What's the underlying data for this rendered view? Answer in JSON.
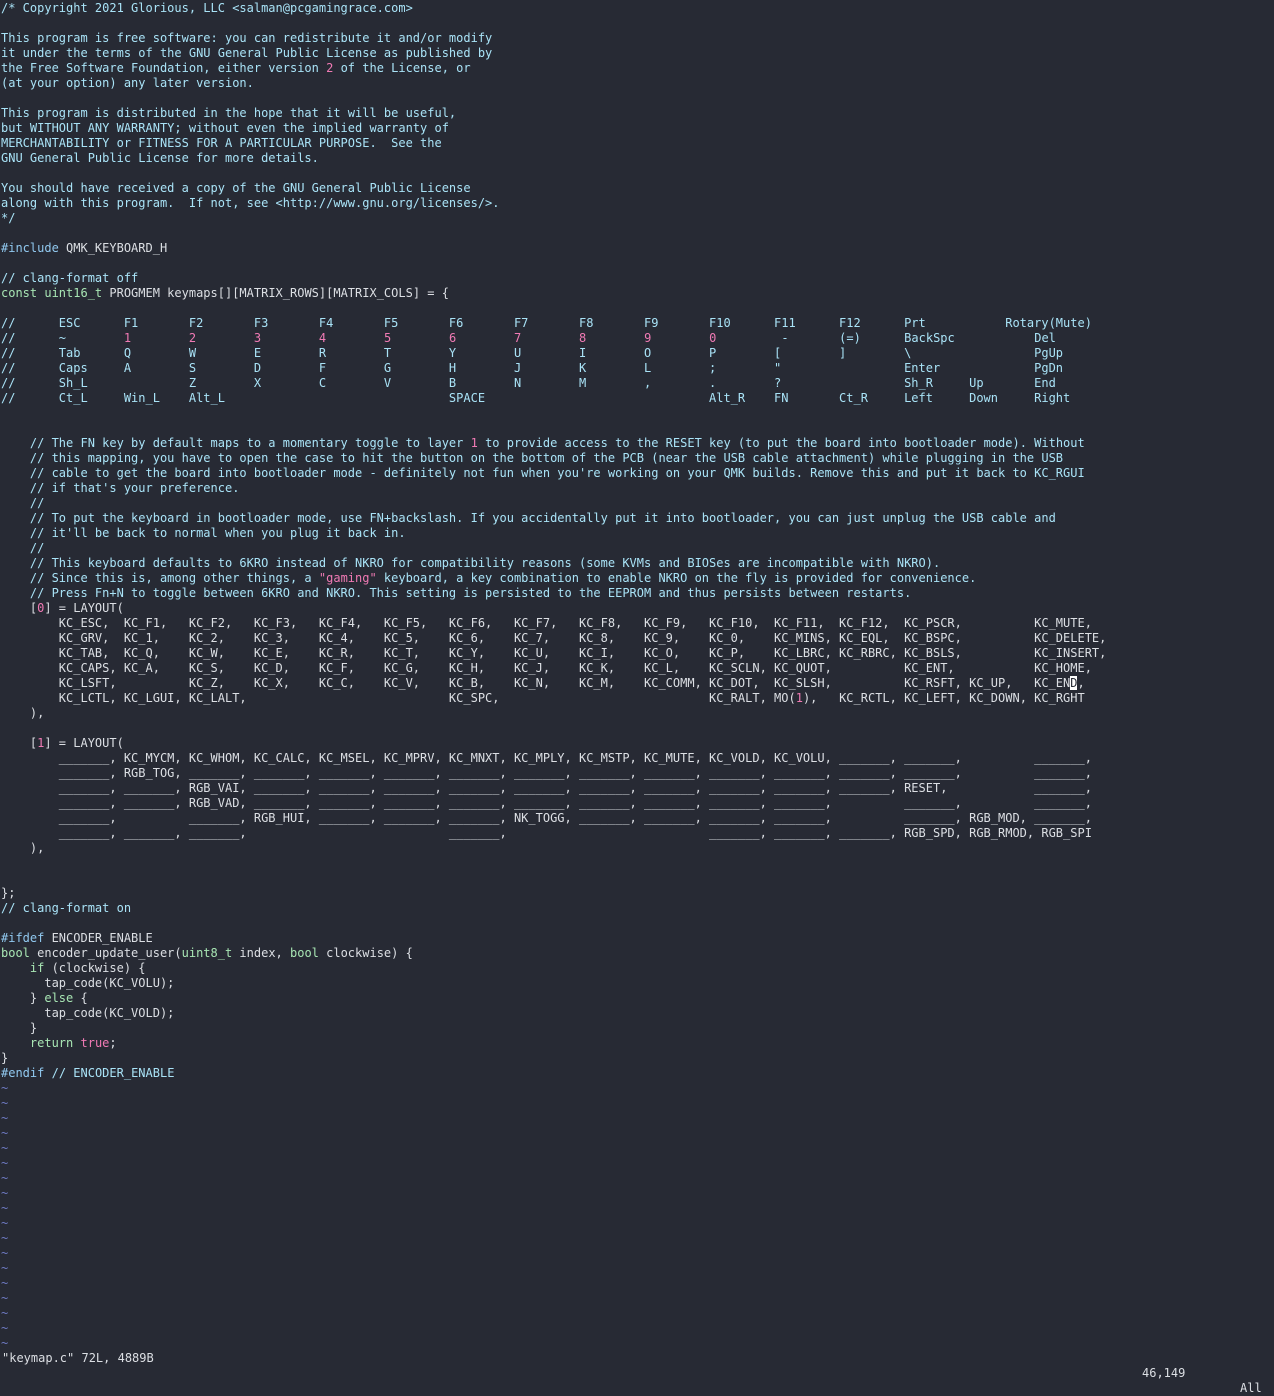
{
  "editor": {
    "lines": [
      {
        "t": "/* Copyright 2021 Glorious, LLC <salman@pcgamingrace.com>",
        "c": "com"
      },
      {
        "t": "",
        "c": ""
      },
      {
        "t": "This program is free software: you can redistribute it and/or modify",
        "c": "com"
      },
      {
        "t": "it under the terms of the GNU General Public License as published by",
        "c": "com"
      },
      {
        "t": "the Free Software Foundation, either version 2 of the License, or",
        "c": "com"
      },
      {
        "t": "(at your option) any later version.",
        "c": "com"
      },
      {
        "t": "",
        "c": ""
      },
      {
        "t": "This program is distributed in the hope that it will be useful,",
        "c": "com"
      },
      {
        "t": "but WITHOUT ANY WARRANTY; without even the implied warranty of",
        "c": "com"
      },
      {
        "t": "MERCHANTABILITY or FITNESS FOR A PARTICULAR PURPOSE.  See the",
        "c": "com"
      },
      {
        "t": "GNU General Public License for more details.",
        "c": "com"
      },
      {
        "t": "",
        "c": ""
      },
      {
        "t": "You should have received a copy of the GNU General Public License",
        "c": "com"
      },
      {
        "t": "along with this program.  If not, see <http://www.gnu.org/licenses/>.",
        "c": "com"
      },
      {
        "t": "*/",
        "c": "com"
      },
      {
        "t": "",
        "c": ""
      },
      {
        "t": "#include QMK_KEYBOARD_H",
        "c": ""
      },
      {
        "t": "",
        "c": ""
      },
      {
        "t": "// clang-format off",
        "c": "com"
      },
      {
        "t": "const uint16_t PROGMEM keymaps[][MATRIX_ROWS][MATRIX_COLS] = {",
        "c": ""
      },
      {
        "t": "",
        "c": ""
      },
      {
        "t": "//      ESC      F1       F2       F3       F4       F5       F6       F7       F8       F9       F10      F11      F12      Prt           Rotary(Mute)",
        "c": "com"
      },
      {
        "t": "//      ~        1        2        3        4        5        6        7        8        9        0         -       (=)      BackSpc           Del",
        "c": "com"
      },
      {
        "t": "//      Tab      Q        W        E        R        T        Y        U        I        O        P        [        ]        \\                 PgUp",
        "c": "com"
      },
      {
        "t": "//      Caps     A        S        D        F        G        H        J        K        L        ;        \"                 Enter             PgDn",
        "c": "com"
      },
      {
        "t": "//      Sh_L              Z        X        C        V        B        N        M        ,        .        ?                 Sh_R     Up       End",
        "c": "com"
      },
      {
        "t": "//      Ct_L     Win_L    Alt_L                               SPACE                               Alt_R    FN       Ct_R     Left     Down     Right",
        "c": "com"
      },
      {
        "t": "",
        "c": ""
      },
      {
        "t": "",
        "c": ""
      },
      {
        "t": "    // The FN key by default maps to a momentary toggle to layer 1 to provide access to the RESET key (to put the board into bootloader mode). Without",
        "c": "com"
      },
      {
        "t": "    // this mapping, you have to open the case to hit the button on the bottom of the PCB (near the USB cable attachment) while plugging in the USB",
        "c": "com"
      },
      {
        "t": "    // cable to get the board into bootloader mode - definitely not fun when you're working on your QMK builds. Remove this and put it back to KC_RGUI",
        "c": "com"
      },
      {
        "t": "    // if that's your preference.",
        "c": "com"
      },
      {
        "t": "    //",
        "c": "com"
      },
      {
        "t": "    // To put the keyboard in bootloader mode, use FN+backslash. If you accidentally put it into bootloader, you can just unplug the USB cable and",
        "c": "com"
      },
      {
        "t": "    // it'll be back to normal when you plug it back in.",
        "c": "com"
      },
      {
        "t": "    //",
        "c": "com"
      },
      {
        "t": "    // This keyboard defaults to 6KRO instead of NKRO for compatibility reasons (some KVMs and BIOSes are incompatible with NKRO).",
        "c": "com"
      },
      {
        "t": "    // Since this is, among other things, a \"gaming\" keyboard, a key combination to enable NKRO on the fly is provided for convenience.",
        "c": "com"
      },
      {
        "t": "    // Press Fn+N to toggle between 6KRO and NKRO. This setting is persisted to the EEPROM and thus persists between restarts.",
        "c": "com"
      },
      {
        "t": "    [0] = LAYOUT(",
        "c": ""
      },
      {
        "t": "        KC_ESC,  KC_F1,   KC_F2,   KC_F3,   KC_F4,   KC_F5,   KC_F6,   KC_F7,   KC_F8,   KC_F9,   KC_F10,  KC_F11,  KC_F12,  KC_PSCR,          KC_MUTE,",
        "c": ""
      },
      {
        "t": "        KC_GRV,  KC_1,    KC_2,    KC_3,    KC_4,    KC_5,    KC_6,    KC_7,    KC_8,    KC_9,    KC_0,    KC_MINS, KC_EQL,  KC_BSPC,          KC_DELETE,",
        "c": ""
      },
      {
        "t": "        KC_TAB,  KC_Q,    KC_W,    KC_E,    KC_R,    KC_T,    KC_Y,    KC_U,    KC_I,    KC_O,    KC_P,    KC_LBRC, KC_RBRC, KC_BSLS,          KC_INSERT,",
        "c": ""
      },
      {
        "t": "        KC_CAPS, KC_A,    KC_S,    KC_D,    KC_F,    KC_G,    KC_H,    KC_J,    KC_K,    KC_L,    KC_SCLN, KC_QUOT,          KC_ENT,           KC_HOME,",
        "c": ""
      },
      {
        "t": "        KC_LSFT,          KC_Z,    KC_X,    KC_C,    KC_V,    KC_B,    KC_N,    KC_M,    KC_COMM, KC_DOT,  KC_SLSH,          KC_RSFT, KC_UP,   KC_END,",
        "c": ""
      },
      {
        "t": "        KC_LCTL, KC_LGUI, KC_LALT,                            KC_SPC,                             KC_RALT, MO(1),   KC_RCTL, KC_LEFT, KC_DOWN, KC_RGHT",
        "c": ""
      },
      {
        "t": "    ),",
        "c": ""
      },
      {
        "t": "",
        "c": ""
      },
      {
        "t": "    [1] = LAYOUT(",
        "c": ""
      },
      {
        "t": "        _______, KC_MYCM, KC_WHOM, KC_CALC, KC_MSEL, KC_MPRV, KC_MNXT, KC_MPLY, KC_MSTP, KC_MUTE, KC_VOLD, KC_VOLU, _______, _______,          _______,",
        "c": ""
      },
      {
        "t": "        _______, RGB_TOG, _______, _______, _______, _______, _______, _______, _______, _______, _______, _______, _______, _______,          _______,",
        "c": ""
      },
      {
        "t": "        _______, _______, RGB_VAI, _______, _______, _______, _______, _______, _______, _______, _______, _______, _______, RESET,            _______,",
        "c": ""
      },
      {
        "t": "        _______, _______, RGB_VAD, _______, _______, _______, _______, _______, _______, _______, _______, _______,          _______,          _______,",
        "c": ""
      },
      {
        "t": "        _______,          _______, RGB_HUI, _______, _______, _______, NK_TOGG, _______, _______, _______, _______,          _______, RGB_MOD, _______,",
        "c": ""
      },
      {
        "t": "        _______, _______, _______,                            _______,                            _______, _______, _______, RGB_SPD, RGB_RMOD, RGB_SPI",
        "c": ""
      },
      {
        "t": "    ),",
        "c": ""
      },
      {
        "t": "",
        "c": ""
      },
      {
        "t": "",
        "c": ""
      },
      {
        "t": "};",
        "c": ""
      },
      {
        "t": "// clang-format on",
        "c": "com"
      },
      {
        "t": "",
        "c": ""
      },
      {
        "t": "#ifdef ENCODER_ENABLE",
        "c": ""
      },
      {
        "t": "bool encoder_update_user(uint8_t index, bool clockwise) {",
        "c": ""
      },
      {
        "t": "    if (clockwise) {",
        "c": ""
      },
      {
        "t": "      tap_code(KC_VOLU);",
        "c": ""
      },
      {
        "t": "    } else {",
        "c": ""
      },
      {
        "t": "      tap_code(KC_VOLD);",
        "c": ""
      },
      {
        "t": "    }",
        "c": ""
      },
      {
        "t": "    return true;",
        "c": ""
      },
      {
        "t": "}",
        "c": ""
      },
      {
        "t": "#endif // ENCODER_ENABLE",
        "c": ""
      },
      {
        "t": "~",
        "c": "tilde"
      },
      {
        "t": "~",
        "c": "tilde"
      },
      {
        "t": "~",
        "c": "tilde"
      },
      {
        "t": "~",
        "c": "tilde"
      },
      {
        "t": "~",
        "c": "tilde"
      },
      {
        "t": "~",
        "c": "tilde"
      },
      {
        "t": "~",
        "c": "tilde"
      },
      {
        "t": "~",
        "c": "tilde"
      },
      {
        "t": "~",
        "c": "tilde"
      },
      {
        "t": "~",
        "c": "tilde"
      },
      {
        "t": "~",
        "c": "tilde"
      },
      {
        "t": "~",
        "c": "tilde"
      },
      {
        "t": "~",
        "c": "tilde"
      },
      {
        "t": "~",
        "c": "tilde"
      },
      {
        "t": "~",
        "c": "tilde"
      },
      {
        "t": "~",
        "c": "tilde"
      },
      {
        "t": "~",
        "c": "tilde"
      },
      {
        "t": "~",
        "c": "tilde"
      }
    ]
  },
  "status": {
    "file": "\"keymap.c\" 72L, 4889B",
    "position": "46,149",
    "scroll": "All"
  },
  "colors": {
    "background": "#272a34",
    "text": "#dcdfe4",
    "comment": "#a9e3f7",
    "number": "#f07ab4",
    "type": "#a8e6b4",
    "tilde": "#6d79c2"
  }
}
